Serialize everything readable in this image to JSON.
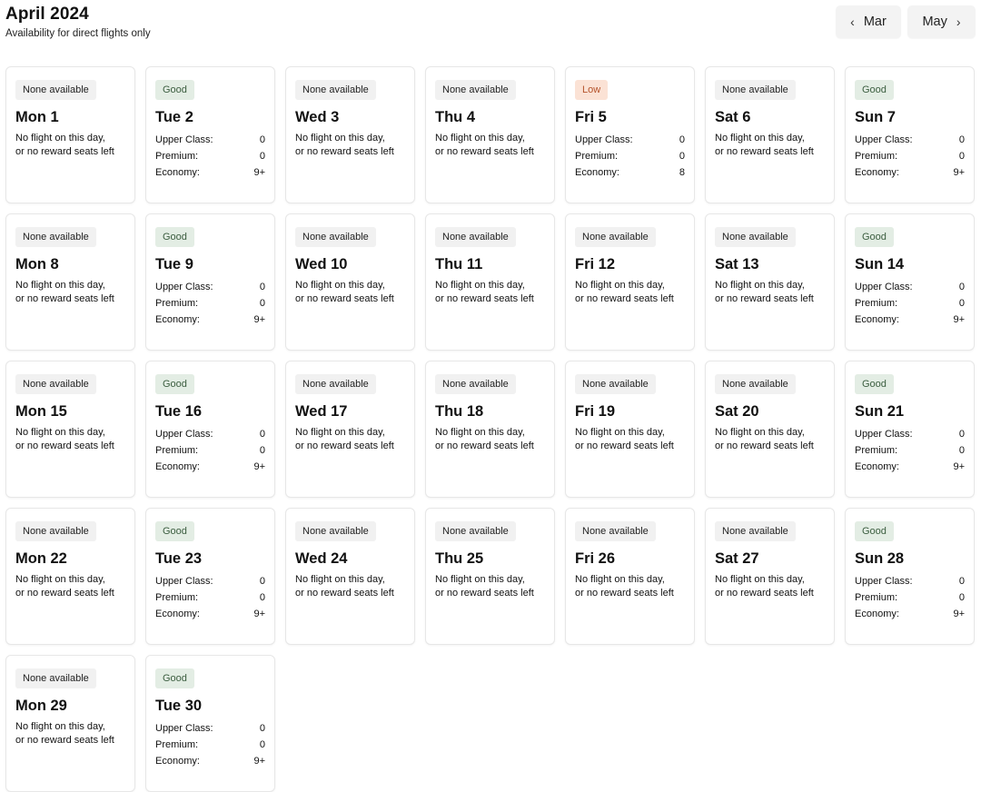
{
  "header": {
    "title": "April 2024",
    "subtitle": "Availability for direct flights only",
    "prev_label": "Mar",
    "next_label": "May"
  },
  "labels": {
    "upper": "Upper Class:",
    "premium": "Premium:",
    "economy": "Economy:",
    "no_flight_line1": "No flight on this day,",
    "no_flight_line2": "or no reward seats left"
  },
  "colors": {
    "good_bg": "#e3ede4",
    "good_text": "#3c5e40",
    "low_bg": "#fbe2d5",
    "low_text": "#b5532b",
    "none_bg": "#f1f1f1"
  },
  "days": [
    {
      "day": "Mon 1",
      "status": "None available",
      "type": "none"
    },
    {
      "day": "Tue 2",
      "status": "Good",
      "type": "good",
      "upper": "0",
      "premium": "0",
      "economy": "9+"
    },
    {
      "day": "Wed 3",
      "status": "None available",
      "type": "none"
    },
    {
      "day": "Thu 4",
      "status": "None available",
      "type": "none"
    },
    {
      "day": "Fri 5",
      "status": "Low",
      "type": "low",
      "upper": "0",
      "premium": "0",
      "economy": "8"
    },
    {
      "day": "Sat 6",
      "status": "None available",
      "type": "none"
    },
    {
      "day": "Sun 7",
      "status": "Good",
      "type": "good",
      "upper": "0",
      "premium": "0",
      "economy": "9+"
    },
    {
      "day": "Mon 8",
      "status": "None available",
      "type": "none"
    },
    {
      "day": "Tue 9",
      "status": "Good",
      "type": "good",
      "upper": "0",
      "premium": "0",
      "economy": "9+"
    },
    {
      "day": "Wed 10",
      "status": "None available",
      "type": "none"
    },
    {
      "day": "Thu 11",
      "status": "None available",
      "type": "none"
    },
    {
      "day": "Fri 12",
      "status": "None available",
      "type": "none"
    },
    {
      "day": "Sat 13",
      "status": "None available",
      "type": "none"
    },
    {
      "day": "Sun 14",
      "status": "Good",
      "type": "good",
      "upper": "0",
      "premium": "0",
      "economy": "9+"
    },
    {
      "day": "Mon 15",
      "status": "None available",
      "type": "none"
    },
    {
      "day": "Tue 16",
      "status": "Good",
      "type": "good",
      "upper": "0",
      "premium": "0",
      "economy": "9+"
    },
    {
      "day": "Wed 17",
      "status": "None available",
      "type": "none"
    },
    {
      "day": "Thu 18",
      "status": "None available",
      "type": "none"
    },
    {
      "day": "Fri 19",
      "status": "None available",
      "type": "none"
    },
    {
      "day": "Sat 20",
      "status": "None available",
      "type": "none"
    },
    {
      "day": "Sun 21",
      "status": "Good",
      "type": "good",
      "upper": "0",
      "premium": "0",
      "economy": "9+"
    },
    {
      "day": "Mon 22",
      "status": "None available",
      "type": "none"
    },
    {
      "day": "Tue 23",
      "status": "Good",
      "type": "good",
      "upper": "0",
      "premium": "0",
      "economy": "9+"
    },
    {
      "day": "Wed 24",
      "status": "None available",
      "type": "none"
    },
    {
      "day": "Thu 25",
      "status": "None available",
      "type": "none"
    },
    {
      "day": "Fri 26",
      "status": "None available",
      "type": "none"
    },
    {
      "day": "Sat 27",
      "status": "None available",
      "type": "none"
    },
    {
      "day": "Sun 28",
      "status": "Good",
      "type": "good",
      "upper": "0",
      "premium": "0",
      "economy": "9+"
    },
    {
      "day": "Mon 29",
      "status": "None available",
      "type": "none"
    },
    {
      "day": "Tue 30",
      "status": "Good",
      "type": "good",
      "upper": "0",
      "premium": "0",
      "economy": "9+"
    }
  ]
}
